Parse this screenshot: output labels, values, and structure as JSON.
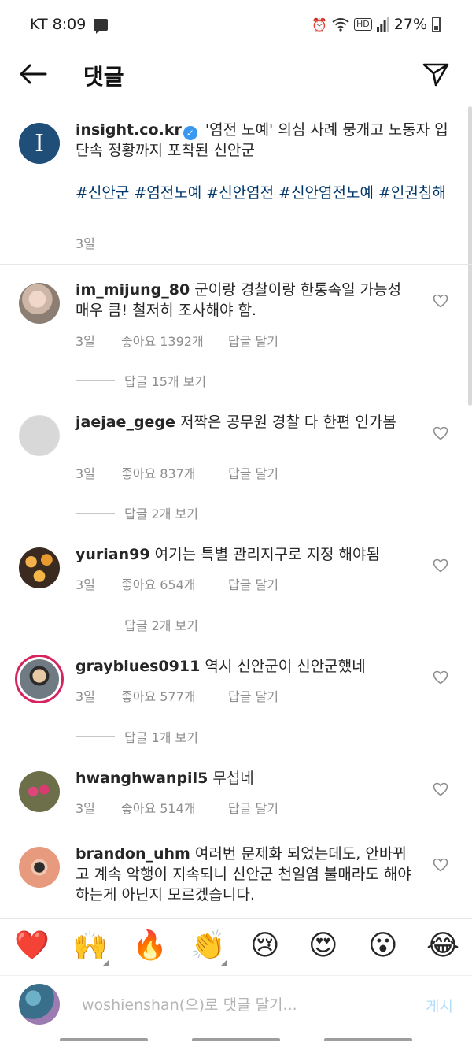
{
  "status_bar": {
    "carrier_time": "KT 8:09",
    "hd": "HD",
    "battery": "27%"
  },
  "header": {
    "title": "댓글"
  },
  "post": {
    "username": "insight.co.kr",
    "avatar_letter": "I",
    "caption": " '염전 노예' 의심 사례 뭉개고 노동자 입단속 정황까지 포착된 신안군",
    "hashtags": "#신안군 #염전노예 #신안염전 #신안염전노예 #인권침해",
    "time": "3일"
  },
  "comments": [
    {
      "username": "im_mijung_80",
      "text": " 군이랑 경찰이랑 한통속일 가능성 매우 큼! 철저히 조사해야 함.",
      "time": "3일",
      "likes": "좋아요 1392개",
      "reply": "답글 달기",
      "view_replies": "답글 15개 보기"
    },
    {
      "username": "jaejae_gege",
      "text": " 저짝은 공무원 경찰 다 한편 인가봄",
      "time": "3일",
      "likes": "좋아요 837개",
      "reply": "답글 달기",
      "view_replies": "답글 2개 보기"
    },
    {
      "username": "yurian99",
      "text": " 여기는 특별 관리지구로 지정 해야됨",
      "time": "3일",
      "likes": "좋아요 654개",
      "reply": "답글 달기",
      "view_replies": "답글 2개 보기"
    },
    {
      "username": "grayblues0911",
      "text": " 역시 신안군이 신안군했네",
      "time": "3일",
      "likes": "좋아요 577개",
      "reply": "답글 달기",
      "view_replies": "답글 1개 보기"
    },
    {
      "username": "hwanghwanpil5",
      "text": " 무섭네",
      "time": "3일",
      "likes": "좋아요 514개",
      "reply": "답글 달기"
    },
    {
      "username": "brandon_uhm",
      "text": " 여러번 문제화 되었는데도, 안바뀌고 계속 악행이 지속되니 신안군 천일염 불매라도 해야하는게 아닌지 모르겠습니다."
    }
  ],
  "emojis": [
    "❤️",
    "🙌",
    "🔥",
    "👏",
    "😢",
    "😍",
    "😮",
    "😂"
  ],
  "input": {
    "placeholder": "woshienshan(으)로 댓글 달기...",
    "post_label": "게시"
  }
}
